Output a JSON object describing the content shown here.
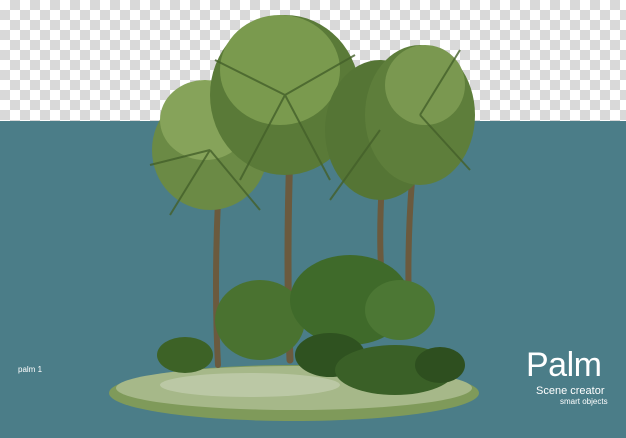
{
  "label": "palm 1",
  "title": "Palm",
  "subtitle": "Scene creator",
  "tagline": "smart objects",
  "colors": {
    "background": "#4b7d88",
    "checker_light": "#ffffff",
    "checker_dark": "#d9d9d9",
    "text": "#ffffff"
  }
}
